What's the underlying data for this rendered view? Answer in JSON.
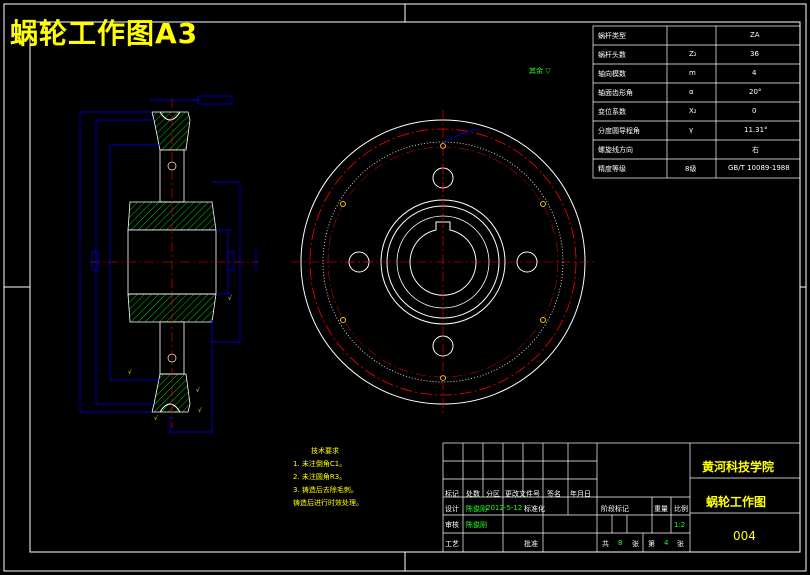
{
  "header": {
    "title": "蜗轮工作图A3"
  },
  "params_table": {
    "rows": [
      {
        "name": "蜗杆类型",
        "symbol": "",
        "value": "ZA"
      },
      {
        "name": "蜗杆头数",
        "symbol": "Z₂",
        "value": "36"
      },
      {
        "name": "轴向模数",
        "symbol": "m",
        "value": "4"
      },
      {
        "name": "轴面齿形角",
        "symbol": "α",
        "value": "20°"
      },
      {
        "name": "变位系数",
        "symbol": "X₂",
        "value": "0"
      },
      {
        "name": "分度圆导程角",
        "symbol": "γ",
        "value": "11.31°"
      },
      {
        "name": "螺旋线方向",
        "symbol": "",
        "value": "右"
      },
      {
        "name": "精度等级",
        "symbol": "8级",
        "value": "GB/T 10089-1988"
      }
    ]
  },
  "roughness_note": {
    "label": "其余",
    "value": "▽"
  },
  "tech_notes": {
    "heading": "技术要求",
    "items": [
      "1. 未注倒角C1。",
      "2. 未注圆角R3。",
      "3. 铸造后去除毛刺。",
      "   铸造后进行时效处理。"
    ]
  },
  "title_block": {
    "school": "黄河科技学院",
    "drawing_name": "蜗轮工作图",
    "drawing_no": "004",
    "scale": "1:2",
    "revision_headers": [
      "标记",
      "处数",
      "分区",
      "更改文件号",
      "签名",
      "年月日"
    ],
    "rows": [
      {
        "label": "设计",
        "name": "陈俊刚",
        "date": "2012-5-12",
        "extra": "标准化"
      },
      {
        "label": "审核",
        "name": "陈俊刚",
        "date": "",
        "extra": ""
      },
      {
        "label": "工艺",
        "name": "",
        "date": "",
        "extra": "批准"
      }
    ],
    "stage_headers": [
      "阶段标记",
      "重量",
      "比例"
    ],
    "sheet_total_label": "共",
    "sheet_total": "8",
    "sheet_unit_1": "张",
    "sheet_no_label": "第",
    "sheet_no": "4",
    "sheet_unit_2": "张"
  },
  "colors": {
    "background": "#000000",
    "frame": "#ffffff",
    "dimension": "#0000ff",
    "hatch": "#00cc00",
    "centerline": "#ff0000",
    "text": "#ffff00"
  }
}
